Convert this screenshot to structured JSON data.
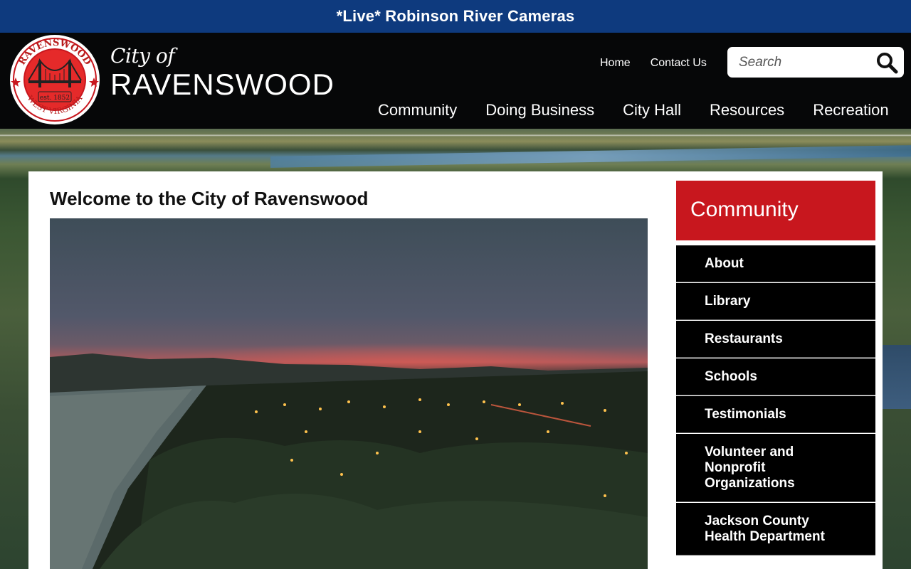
{
  "banner": {
    "text": "*Live* Robinson River Cameras"
  },
  "header": {
    "logo": {
      "city_of": "City of",
      "name": "RAVENSWOOD",
      "seal_top": "RAVENSWOOD",
      "seal_bottom": "WEST VIRGINIA",
      "seal_est": "est. 1852"
    },
    "utility_nav": [
      "Home",
      "Contact Us"
    ],
    "search": {
      "placeholder": "Search"
    },
    "main_nav": [
      "Community",
      "Doing Business",
      "City Hall",
      "Resources",
      "Recreation"
    ]
  },
  "colors": {
    "banner_blue": "#0e3a7e",
    "header_black": "#060708",
    "accent_red": "#c8171e"
  },
  "main": {
    "title": "Welcome to the City of Ravenswood"
  },
  "sidebar": {
    "heading": "Community",
    "items": [
      {
        "label": "About"
      },
      {
        "label": "Library"
      },
      {
        "label": "Restaurants"
      },
      {
        "label": "Schools"
      },
      {
        "label": "Testimonials"
      },
      {
        "label": "Volunteer and Nonprofit Organizations"
      },
      {
        "label": "Jackson County Health Department"
      }
    ]
  }
}
